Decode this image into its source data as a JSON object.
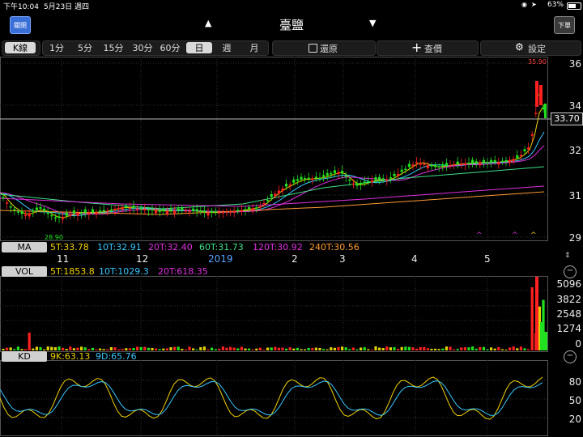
{
  "status": {
    "time": "下午10:04",
    "date": "5月23日 週四",
    "battery": "63%"
  },
  "header": {
    "close_label": "關閉",
    "prev_arrow": "▲",
    "title": "臺鹽",
    "next_arrow": "▼",
    "order_label": "下單"
  },
  "toolbar": {
    "kline_label": "K線",
    "timeframes": [
      "1分",
      "5分",
      "15分",
      "30分",
      "60分",
      "日",
      "週",
      "月"
    ],
    "selected_timeframe": "日",
    "restore_label": "還原",
    "query_label": "查價",
    "settings_label": "設定"
  },
  "price_axis": {
    "labels": [
      "36",
      "34",
      "32",
      "31",
      "29"
    ],
    "current_price": "33.70"
  },
  "annotations": {
    "high": "35.90",
    "low": "28.90"
  },
  "ma": {
    "tag": "MA",
    "items": [
      {
        "label": "5T:33.78",
        "color": "#f2d200"
      },
      {
        "label": "10T:32.91",
        "color": "#38c7ff"
      },
      {
        "label": "20T:32.40",
        "color": "#e02fe0"
      },
      {
        "label": "60T:31.73",
        "color": "#3fe28a"
      },
      {
        "label": "120T:30.92",
        "color": "#e02fe0"
      },
      {
        "label": "240T:30.56",
        "color": "#ff9a33"
      }
    ]
  },
  "x_axis": [
    "11",
    "12",
    "2019",
    "2",
    "3",
    "4",
    "5"
  ],
  "vol": {
    "tag": "VOL",
    "items": [
      {
        "label": "5T:1853.8",
        "color": "#f2d200"
      },
      {
        "label": "10T:1029.3",
        "color": "#38c7ff"
      },
      {
        "label": "20T:618.35",
        "color": "#e02fe0"
      }
    ],
    "axis": [
      "5096",
      "3822",
      "2548",
      "1274",
      "0"
    ]
  },
  "kd": {
    "tag": "KD",
    "items": [
      {
        "label": "9K:63.13",
        "color": "#f2d200"
      },
      {
        "label": "9D:65.76",
        "color": "#38c7ff"
      }
    ],
    "axis": [
      "80",
      "50",
      "20"
    ]
  },
  "colors": {
    "up": "#ff2020",
    "down": "#20e020",
    "frame": "#888888"
  }
}
